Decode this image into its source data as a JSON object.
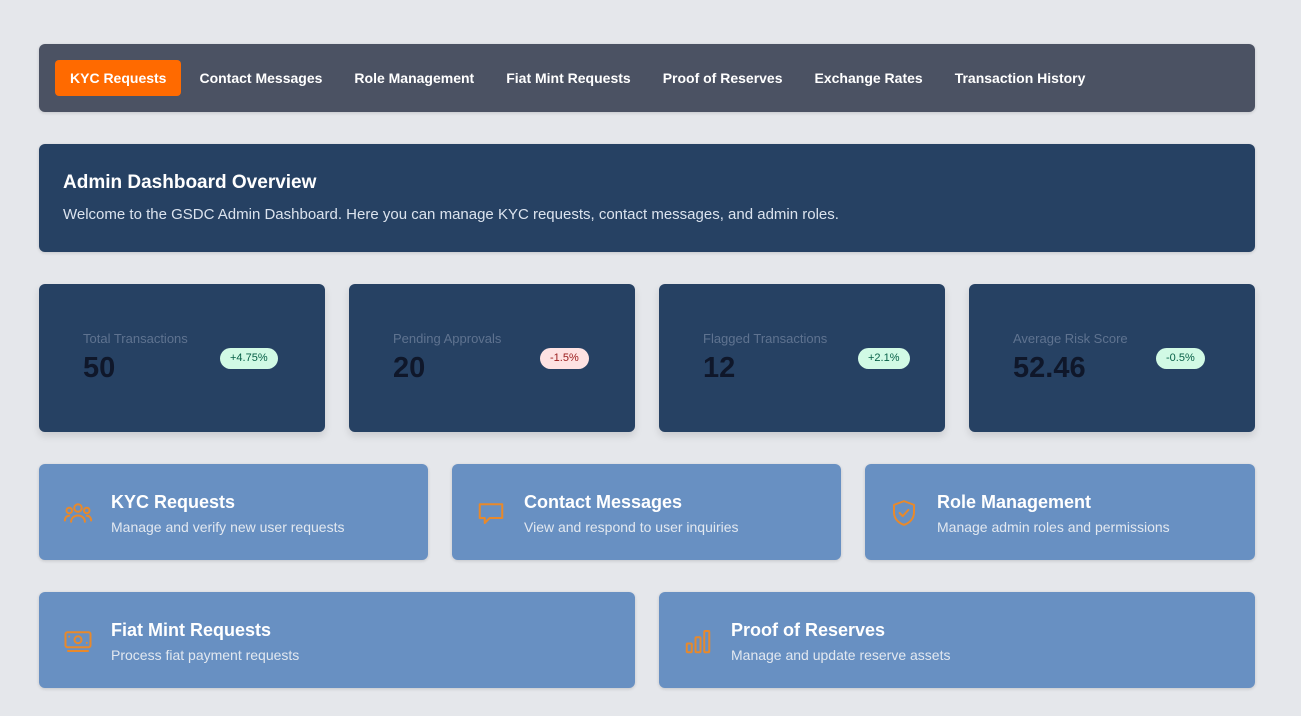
{
  "nav": {
    "items": [
      {
        "label": "KYC Requests",
        "active": true
      },
      {
        "label": "Contact Messages",
        "active": false
      },
      {
        "label": "Role Management",
        "active": false
      },
      {
        "label": "Fiat Mint Requests",
        "active": false
      },
      {
        "label": "Proof of Reserves",
        "active": false
      },
      {
        "label": "Exchange Rates",
        "active": false
      },
      {
        "label": "Transaction History",
        "active": false
      }
    ],
    "active_color": "#ff6a00"
  },
  "overview": {
    "title": "Admin Dashboard Overview",
    "description": "Welcome to the GSDC Admin Dashboard. Here you can manage KYC requests, contact messages, and admin roles."
  },
  "stats": [
    {
      "label": "Total Transactions",
      "value": "50",
      "change": "+4.75%",
      "trend": "up"
    },
    {
      "label": "Pending Approvals",
      "value": "20",
      "change": "-1.5%",
      "trend": "down"
    },
    {
      "label": "Flagged Transactions",
      "value": "12",
      "change": "+2.1%",
      "trend": "up"
    },
    {
      "label": "Average Risk Score",
      "value": "52.46",
      "change": "-0.5%",
      "trend": "up"
    }
  ],
  "cards": [
    {
      "title": "KYC Requests",
      "description": "Manage and verify new user requests",
      "icon": "users-icon"
    },
    {
      "title": "Contact Messages",
      "description": "View and respond to user inquiries",
      "icon": "message-icon"
    },
    {
      "title": "Role Management",
      "description": "Manage admin roles and permissions",
      "icon": "shield-check-icon"
    },
    {
      "title": "Fiat Mint Requests",
      "description": "Process fiat payment requests",
      "icon": "banknote-icon"
    },
    {
      "title": "Proof of Reserves",
      "description": "Manage and update reserve assets",
      "icon": "bar-chart-icon"
    }
  ],
  "colors": {
    "icon_accent": "#e8892b",
    "card_bg": "#6890c2",
    "panel_bg": "#264163"
  }
}
